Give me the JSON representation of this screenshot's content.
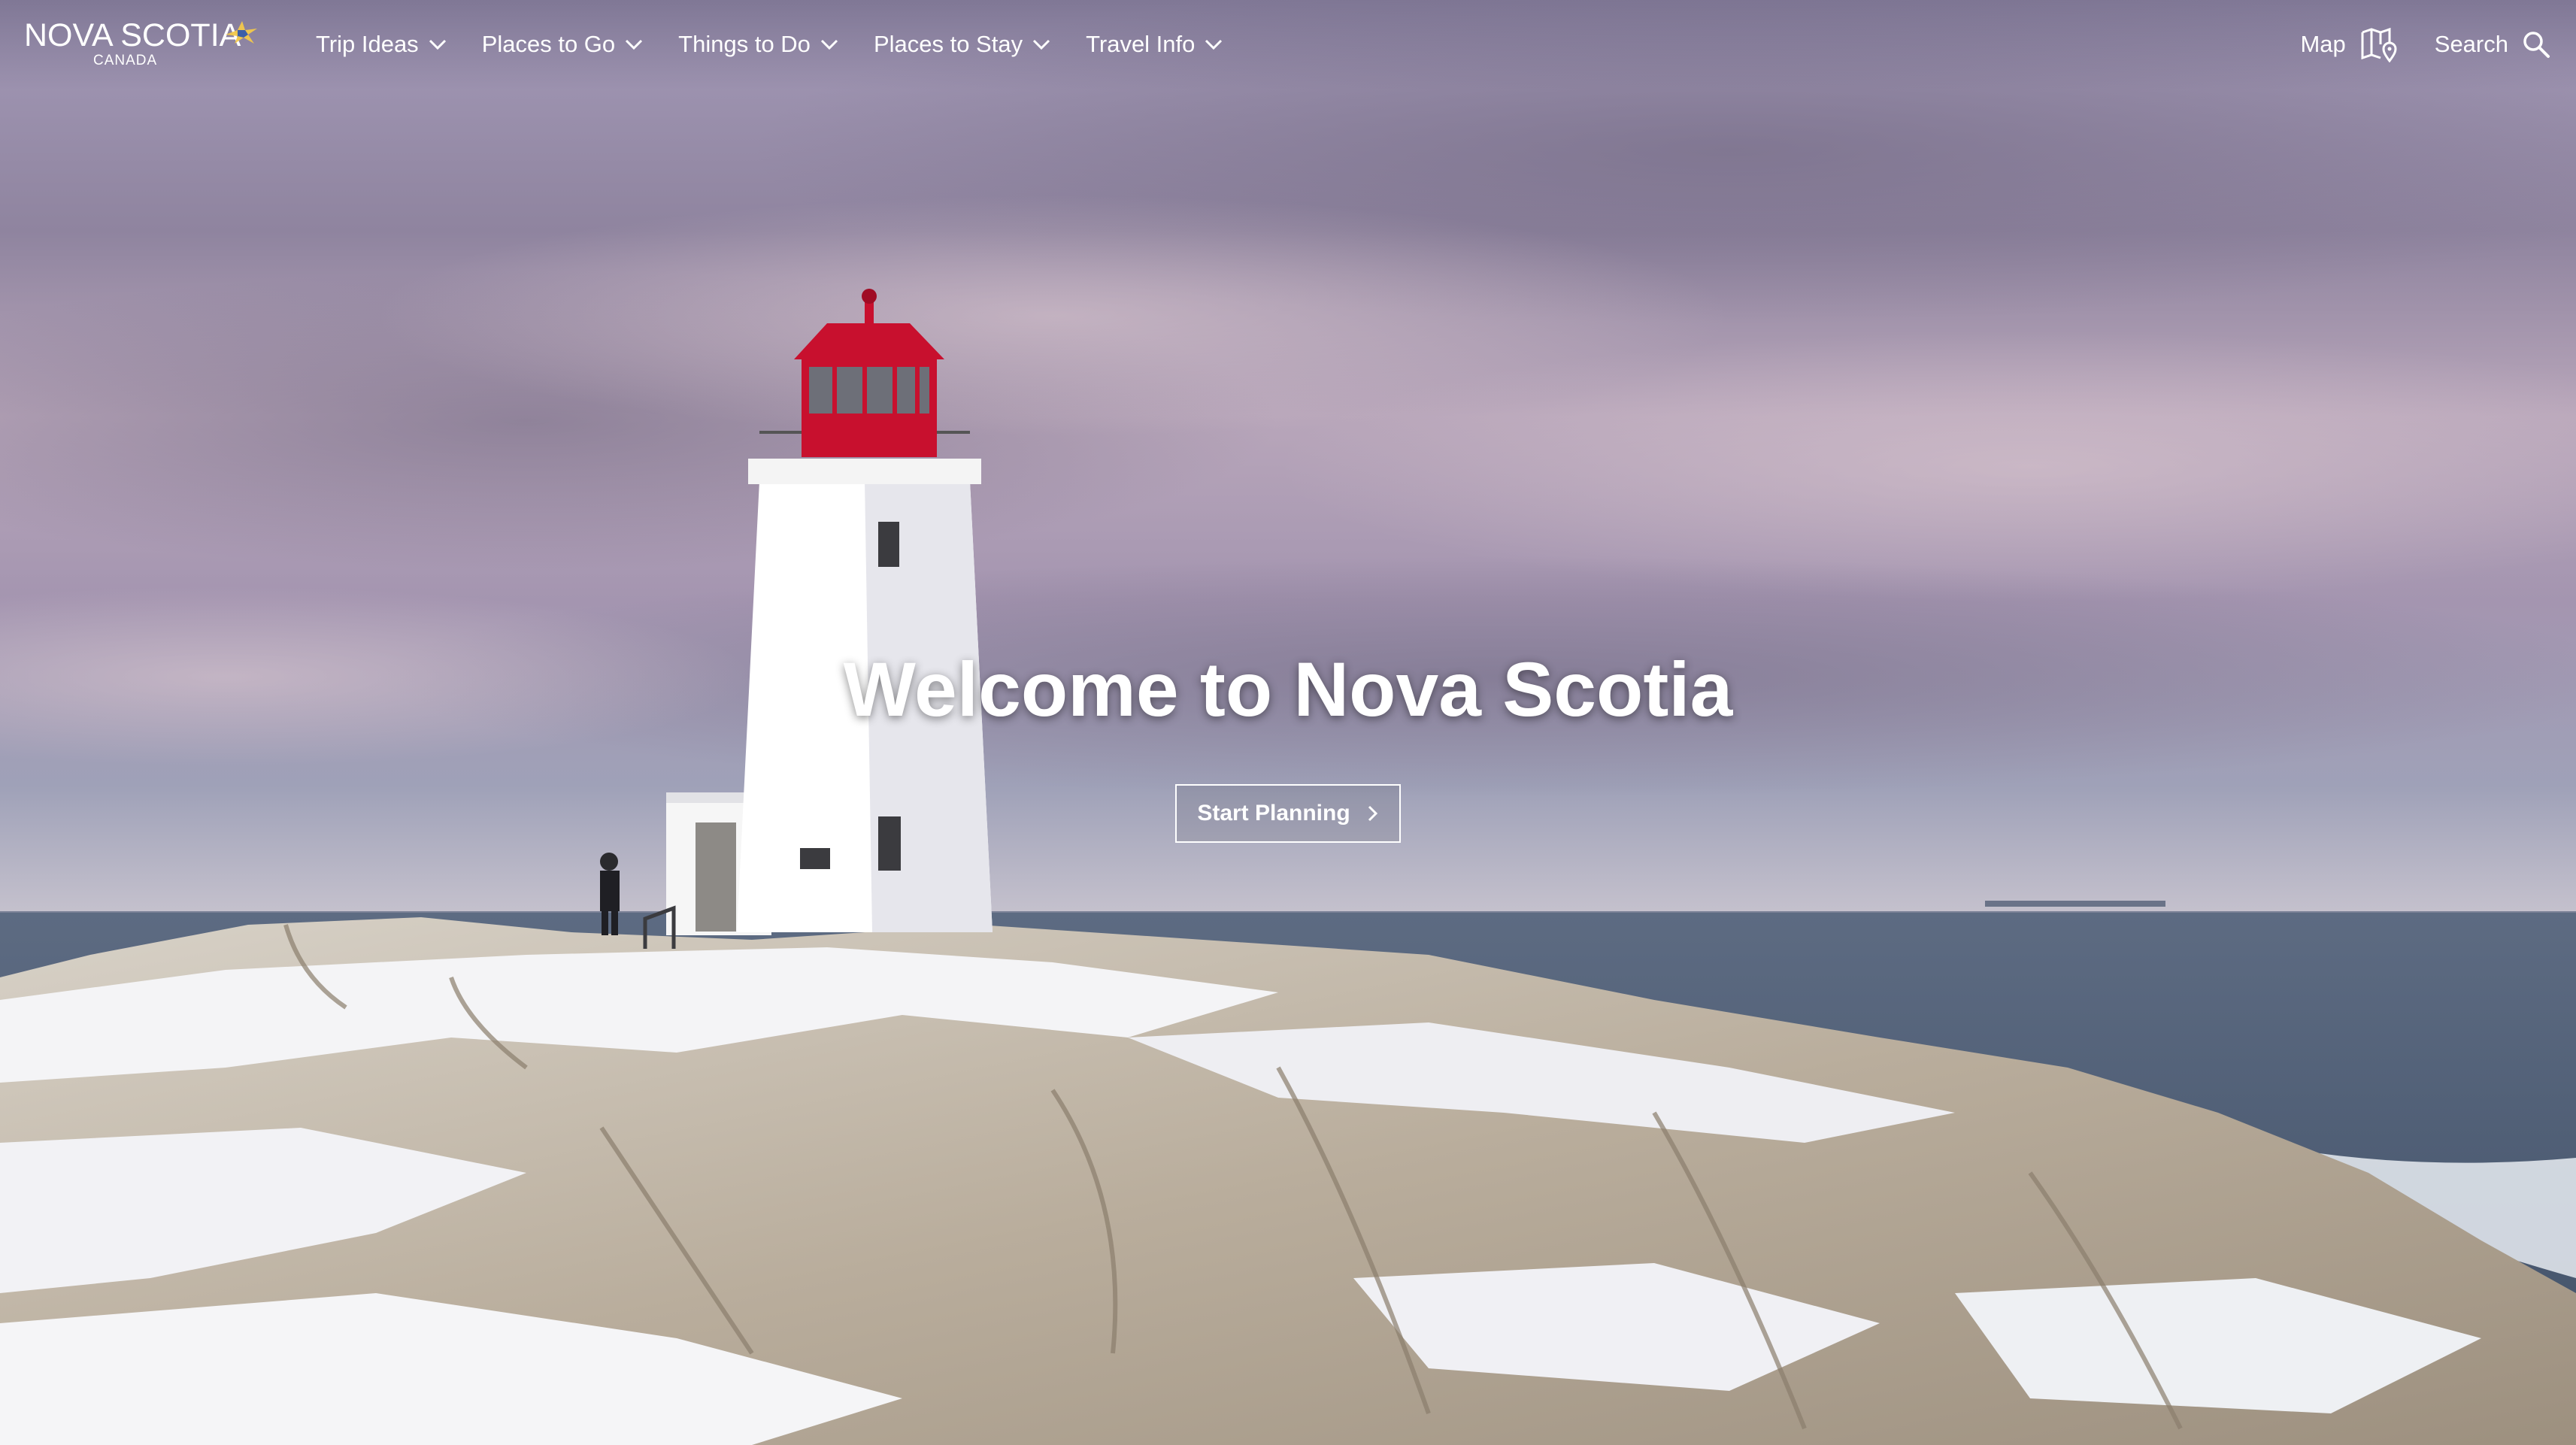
{
  "header": {
    "logo_main": "NOVA SCOTIA",
    "logo_sub": "CANADA",
    "nav_items": [
      {
        "label": "Trip Ideas"
      },
      {
        "label": "Places to Go"
      },
      {
        "label": "Things to Do"
      },
      {
        "label": "Places to Stay"
      },
      {
        "label": "Travel Info"
      }
    ],
    "map_label": "Map",
    "search_label": "Search"
  },
  "hero": {
    "title": "Welcome to Nova Scotia",
    "cta_label": "Start Planning",
    "image_description_icon": "lighthouse-photo"
  },
  "icons": {
    "dropdown": "chevron-down-icon",
    "map": "map-pin-icon",
    "search": "search-icon",
    "cta": "chevron-right-icon"
  },
  "colors": {
    "text": "#ffffff",
    "lighthouse_red": "#c8102e",
    "sky_purple": "#9a8fb0",
    "ocean": "#4e6076"
  }
}
